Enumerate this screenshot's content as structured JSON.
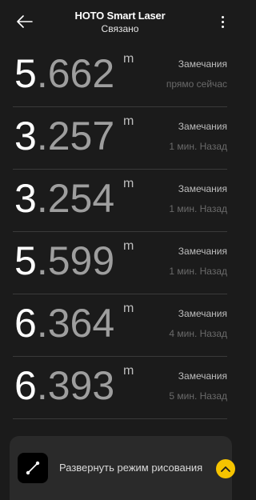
{
  "header": {
    "title": "HOTO Smart Laser",
    "subtitle": "Связано"
  },
  "icons": {
    "back": "arrow-left-icon",
    "menu": "kebab-menu-icon",
    "draw": "line-segment-icon",
    "expand": "chevron-up-icon"
  },
  "measurements": [
    {
      "int": "5",
      "dec": ".662",
      "unit": "m",
      "label": "Замечания",
      "time": "прямо сейчас"
    },
    {
      "int": "3",
      "dec": ".257",
      "unit": "m",
      "label": "Замечания",
      "time": "1 мин. Назад"
    },
    {
      "int": "3",
      "dec": ".254",
      "unit": "m",
      "label": "Замечания",
      "time": "1 мин. Назад"
    },
    {
      "int": "5",
      "dec": ".599",
      "unit": "m",
      "label": "Замечания",
      "time": "1 мин. Назад"
    },
    {
      "int": "6",
      "dec": ".364",
      "unit": "m",
      "label": "Замечания",
      "time": "4 мин. Назад"
    },
    {
      "int": "6",
      "dec": ".393",
      "unit": "m",
      "label": "Замечания",
      "time": "5 мин. Назад"
    }
  ],
  "bottom_sheet": {
    "label": "Развернуть режим рисования"
  },
  "colors": {
    "background": "#1b1b1b",
    "accent": "#f5c300",
    "sheet": "#2a2a2a"
  }
}
